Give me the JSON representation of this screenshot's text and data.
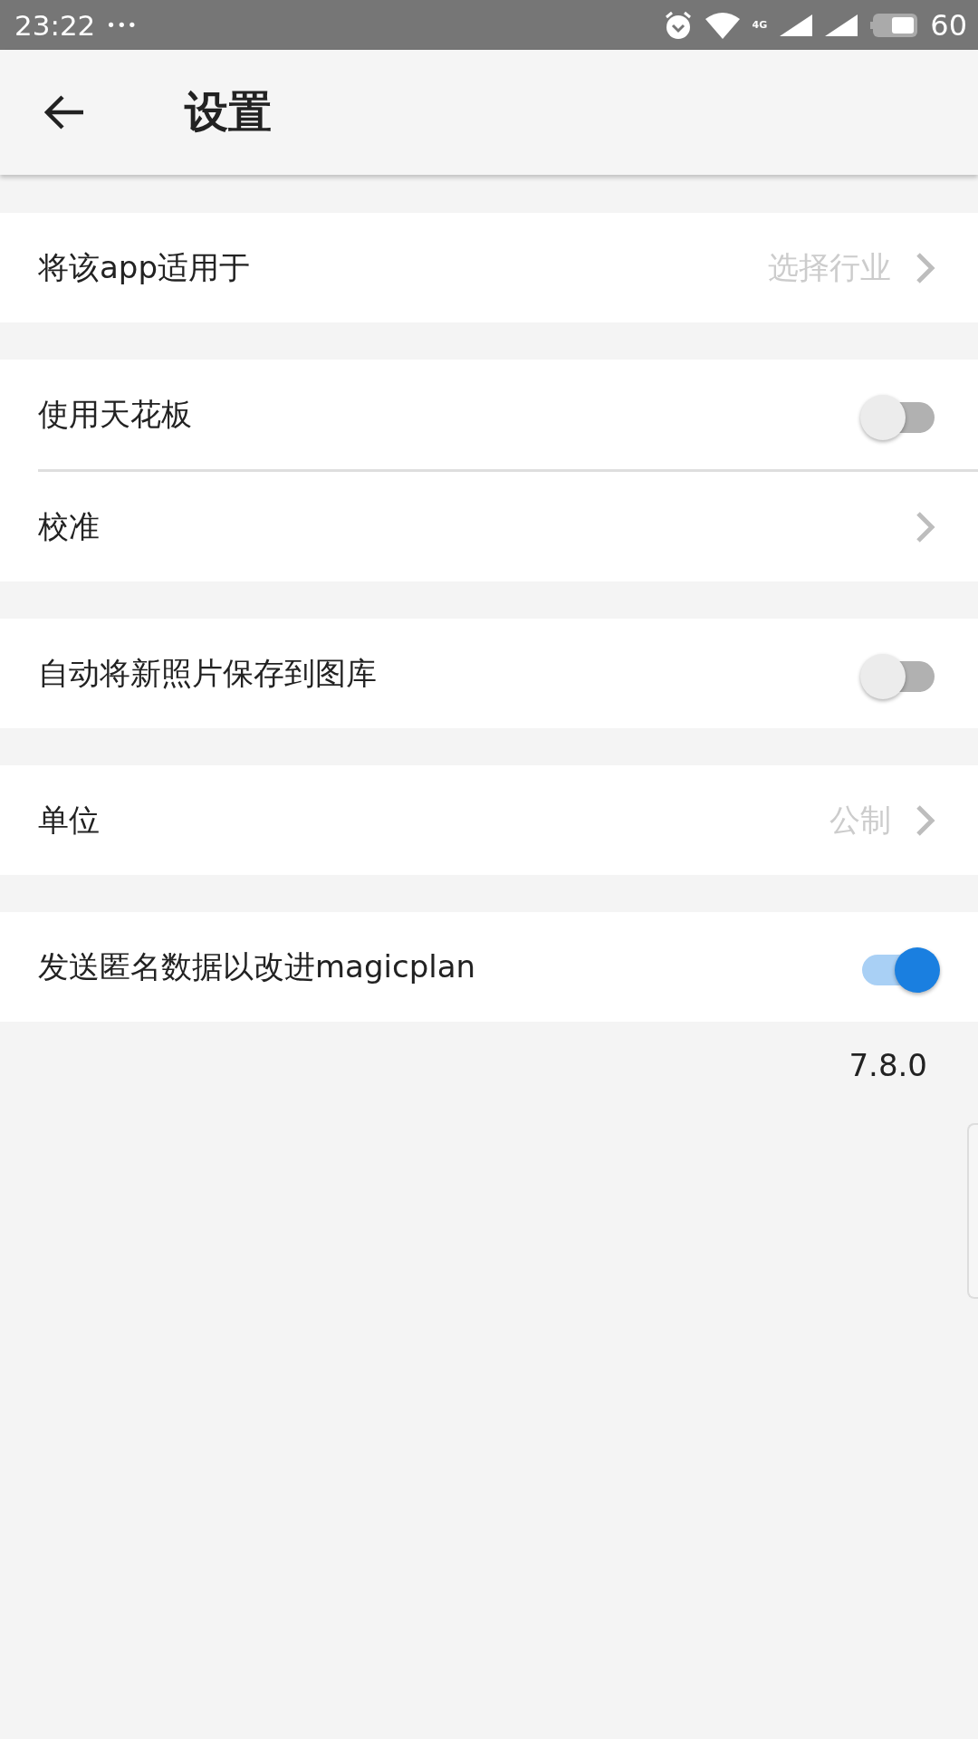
{
  "status_bar": {
    "time": "23:22",
    "more": "•••",
    "network": "4G",
    "battery": "60"
  },
  "app_bar": {
    "title": "设置"
  },
  "groups": [
    {
      "rows": [
        {
          "kind": "link",
          "label": "将该app适用于",
          "value": "选择行业"
        }
      ]
    },
    {
      "rows": [
        {
          "kind": "toggle",
          "label": "使用天花板",
          "on": false
        },
        {
          "kind": "link",
          "label": "校准"
        }
      ]
    },
    {
      "rows": [
        {
          "kind": "toggle",
          "label": "自动将新照片保存到图库",
          "on": false
        }
      ]
    },
    {
      "rows": [
        {
          "kind": "link",
          "label": "单位",
          "value": "公制"
        }
      ]
    },
    {
      "rows": [
        {
          "kind": "toggle",
          "label": "发送匿名数据以改进magicplan",
          "on": true
        }
      ]
    }
  ],
  "version": "7.8.0"
}
